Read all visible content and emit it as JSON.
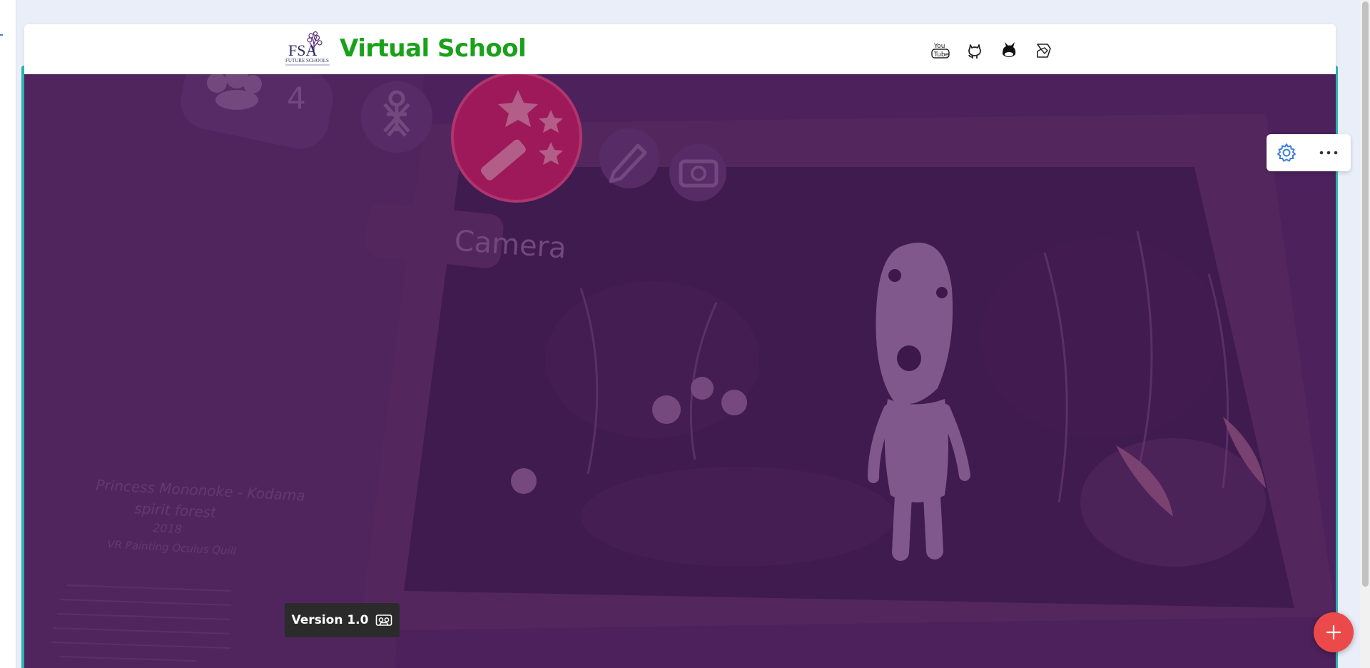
{
  "header": {
    "logo_text": "FSA",
    "logo_caption": "FUTURE SCHOOLS",
    "title": "Virtual School",
    "social": [
      {
        "name": "youtube",
        "icon": "youtube-icon"
      },
      {
        "name": "github",
        "icon": "github-icon"
      },
      {
        "name": "scratch",
        "icon": "scratch-cat-icon"
      },
      {
        "name": "codepen",
        "icon": "codepen-icon"
      }
    ]
  },
  "stage": {
    "participants_count": "4",
    "camera_label": "Camera",
    "poster_title_line1": "Princess Mononoke - Kodama",
    "poster_title_line2": "spirit forest",
    "poster_year": "2018",
    "poster_medium": "VR Painting Oculus Quill"
  },
  "side_tools": {
    "settings_icon": "gear-icon",
    "more_icon": "more-horizontal-icon"
  },
  "footer": {
    "version_label": "Version 1.0",
    "version_icon": "cassette-icon",
    "fab_icon": "plus-icon"
  },
  "colors": {
    "title_green": "#19a119",
    "stage_purple": "#4c225c",
    "fab_red": "#ec4a4a",
    "accent_teal": "#2bb3b3",
    "settings_blue": "#3f7fd6"
  }
}
